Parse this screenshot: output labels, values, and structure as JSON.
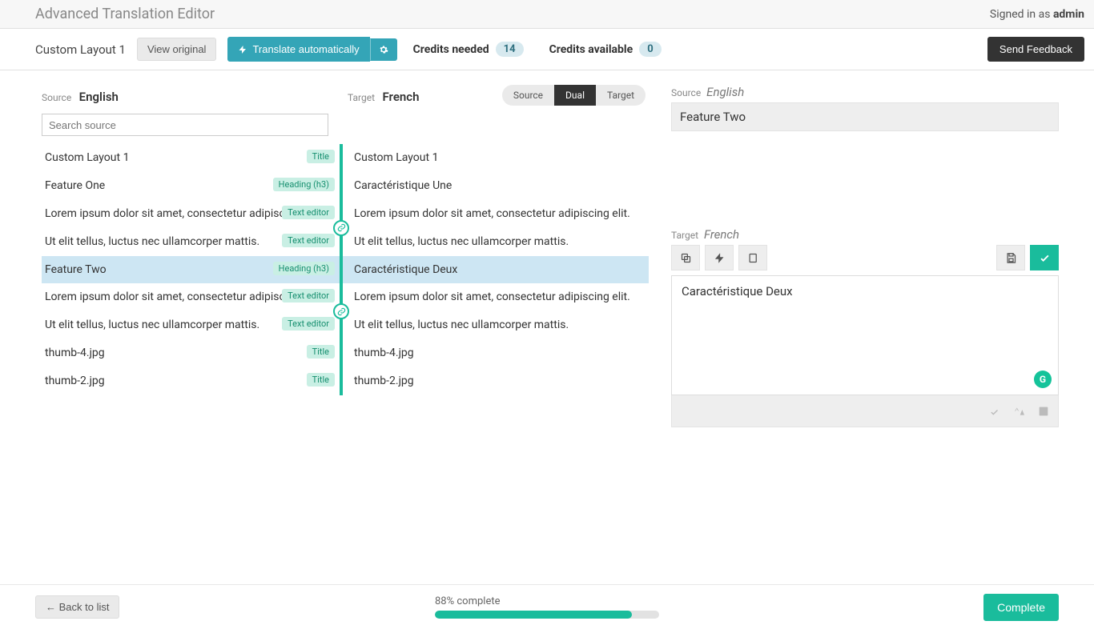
{
  "header": {
    "app_title": "Advanced Translation Editor",
    "signed_in_prefix": "Signed in as ",
    "signed_in_user": "admin"
  },
  "toolbar": {
    "layout_name": "Custom Layout 1",
    "view_original": "View original",
    "translate_auto": "Translate automatically",
    "credits_needed_label": "Credits needed",
    "credits_needed_value": "14",
    "credits_available_label": "Credits available",
    "credits_available_value": "0",
    "send_feedback": "Send Feedback"
  },
  "lang": {
    "source_label": "Source",
    "source_lang": "English",
    "target_label": "Target",
    "target_lang": "French"
  },
  "view_toggle": {
    "source": "Source",
    "dual": "Dual",
    "target": "Target"
  },
  "search": {
    "placeholder": "Search source"
  },
  "rows": [
    {
      "src": "Custom Layout 1",
      "badge": "Title",
      "tgt": "Custom Layout 1",
      "link": false
    },
    {
      "src": "Feature One",
      "badge": "Heading (h3)",
      "tgt": "Caractéristique Une",
      "link": false
    },
    {
      "src": "Lorem ipsum dolor sit amet, consectetur adipiscing elit.",
      "badge": "Text editor",
      "tgt": "Lorem ipsum dolor sit amet, consectetur adipiscing elit.",
      "link": true
    },
    {
      "src": "Ut elit tellus, luctus nec ullamcorper mattis.",
      "badge": "Text editor",
      "tgt": "Ut elit tellus, luctus nec ullamcorper mattis.",
      "link": false
    },
    {
      "src": "Feature Two",
      "badge": "Heading (h3)",
      "tgt": "Caractéristique Deux",
      "link": false,
      "selected": true
    },
    {
      "src": "Lorem ipsum dolor sit amet, consectetur adipiscing elit.",
      "badge": "Text editor",
      "tgt": "Lorem ipsum dolor sit amet, consectetur adipiscing elit.",
      "link": true
    },
    {
      "src": "Ut elit tellus, luctus nec ullamcorper mattis.",
      "badge": "Text editor",
      "tgt": "Ut elit tellus, luctus nec ullamcorper mattis.",
      "link": false
    },
    {
      "src": "thumb-4.jpg",
      "badge": "Title",
      "tgt": "thumb-4.jpg",
      "link": false
    },
    {
      "src": "thumb-2.jpg",
      "badge": "Title",
      "tgt": "thumb-2.jpg",
      "link": false
    }
  ],
  "panel": {
    "source_label": "Source",
    "source_lang": "English",
    "source_text": "Feature Two",
    "target_label": "Target",
    "target_lang": "French",
    "target_text": "Caractéristique Deux",
    "grammarly": "G"
  },
  "footer": {
    "back_label": "←  Back to list",
    "progress_pct": 88,
    "progress_label": "88% complete",
    "complete_label": "Complete"
  }
}
